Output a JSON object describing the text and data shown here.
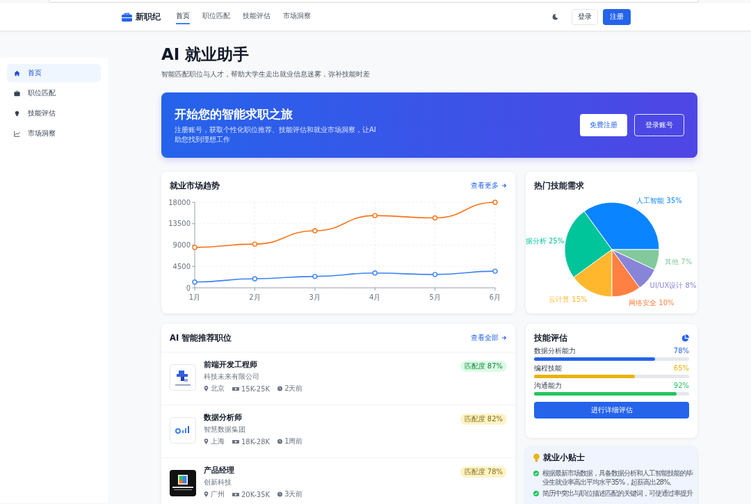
{
  "header": {
    "logo": "新职纪",
    "nav": [
      {
        "label": "首页",
        "selected": true
      },
      {
        "label": "职位匹配",
        "selected": false
      },
      {
        "label": "技能评估",
        "selected": false
      },
      {
        "label": "市场洞察",
        "selected": false
      }
    ],
    "login": "登录",
    "register": "注册"
  },
  "sidebar": {
    "items": [
      {
        "label": "首页",
        "selected": true
      },
      {
        "label": "职位匹配",
        "selected": false
      },
      {
        "label": "技能评估",
        "selected": false
      },
      {
        "label": "市场洞察",
        "selected": false
      }
    ]
  },
  "page": {
    "title": "AI 就业助手",
    "subtitle": "智能匹配职位与人才，帮助大学生走出就业信息迷雾，弥补技能时差"
  },
  "banner": {
    "title": "开始您的智能求职之旅",
    "text": "注册账号，获取个性化职位推荐、技能评估和就业市场洞察，让AI助您找到理想工作",
    "primary": "免费注册",
    "secondary": "登录账号"
  },
  "trend": {
    "title": "就业市场趋势",
    "link": "查看更多",
    "chart_data": {
      "type": "line",
      "grid": true,
      "categories": [
        "1月",
        "2月",
        "3月",
        "4月",
        "5月",
        "6月"
      ],
      "ylim": [
        0,
        18000
      ],
      "yticks": [
        0,
        4500,
        9000,
        13500,
        18000
      ],
      "series": [
        {
          "color": "#f97316",
          "marker": "circle",
          "values": [
            8500,
            9200,
            12000,
            15200,
            14700,
            18000
          ]
        },
        {
          "color": "#3b82f6",
          "marker": "circle",
          "values": [
            1200,
            1900,
            2400,
            3100,
            2800,
            3500
          ]
        }
      ]
    }
  },
  "skills_demand": {
    "title": "热门技能需求",
    "chart_data": {
      "type": "pie",
      "categories": [
        "人工智能",
        "据分析",
        "云计算",
        "网络安全",
        "UI/UX设计",
        "其他"
      ],
      "value_labels": [
        "35%",
        "25%",
        "15%",
        "10%",
        "8%",
        "7%"
      ],
      "series": [
        {
          "values": [
            35,
            25,
            15,
            10,
            8,
            7
          ],
          "colors": [
            "#0a84ff",
            "#00c49a",
            "#ffb82e",
            "#ff8042",
            "#8884d8",
            "#82c99b"
          ]
        }
      ]
    }
  },
  "jobs": {
    "title": "AI 智能推荐职位",
    "link": "查看全部",
    "items": [
      {
        "title": "前端开发工程师",
        "company": "科技未来有限公司",
        "city": "北京",
        "salary": "15K-25K",
        "posted": "2天前",
        "match": "匹配度 87%",
        "color": "#dcfce7"
      },
      {
        "title": "数据分析师",
        "company": "智慧数据集团",
        "city": "上海",
        "salary": "18K-28K",
        "posted": "1周前",
        "match": "匹配度 82%",
        "color": "#fef3c7"
      },
      {
        "title": "产品经理",
        "company": "创新科技",
        "city": "广州",
        "salary": "20K-35K",
        "posted": "3天前",
        "match": "匹配度 78%",
        "color": "#fef3c7"
      }
    ]
  },
  "assessment": {
    "title": "技能评估",
    "button": "进行详细评估",
    "skills": [
      {
        "name": "数据分析能力",
        "reading": "78%",
        "level": 0.78,
        "color": "#2563eb"
      },
      {
        "name": "编程技能",
        "reading": "65%",
        "level": 0.65,
        "color": "#eab308"
      },
      {
        "name": "沟通能力",
        "reading": "92%",
        "level": 0.92,
        "color": "#22c55e"
      }
    ]
  },
  "tips": {
    "title": "就业小贴士",
    "items": [
      "根据最新市场数据，具备数据分析和人工智能技能的毕业生就业率高出平均水平35%，起薪高出28%。",
      "简历中突出与职位描述匹配的关键词，可使通过率提升"
    ]
  }
}
